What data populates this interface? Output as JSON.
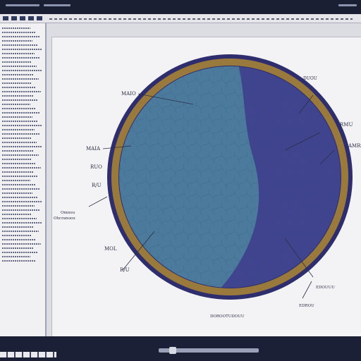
{
  "window": {
    "title": ""
  },
  "toolbar": {
    "icons": [
      "file-icon",
      "save-icon",
      "undo-icon",
      "redo-icon",
      "zoom-icon",
      "pen-icon",
      "text-icon",
      "shape-icon"
    ]
  },
  "sidebar": {
    "title": "",
    "line_count": 56
  },
  "figure": {
    "colors": {
      "rim_gold": "#9a7a3c",
      "outer_ring": "#2e2d6e",
      "left_region": "#4c7a9c",
      "right_region": "#40448f",
      "leader_lines": "#2b2f45"
    },
    "labels": {
      "top_left": "MAIO",
      "left_upper": "MAIA",
      "left_mid": "RUO",
      "left_mid2": "R/U",
      "left_lower_1": "Omnou",
      "left_lower_2": "Ohcranoou",
      "left_bottom_1": "MOL",
      "left_bottom_2": "R/U",
      "right_top": "DUOU",
      "right_upper": "RMU",
      "right_mid": "AMRA",
      "right_lower_1": "EDOUUU",
      "right_lower_2": "EDROU",
      "bottom": "DOROOTUDOUU"
    }
  },
  "statusbar": {
    "text": ""
  }
}
